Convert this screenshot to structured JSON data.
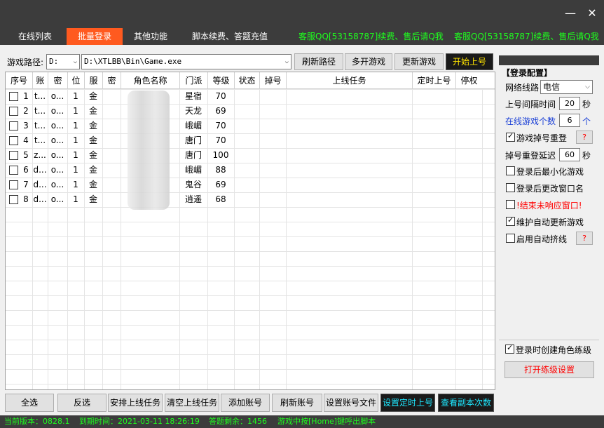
{
  "tabs": [
    {
      "label": "在线列表"
    },
    {
      "label": "批量登录"
    },
    {
      "label": "其他功能"
    },
    {
      "label": "脚本续费、答题充值"
    }
  ],
  "support": [
    "客服QQ[53158787]续费、售后请Q我",
    "客服QQ[53158787]续费、售后请Q我"
  ],
  "path": {
    "label": "游戏路径:",
    "drive": "D:",
    "exe": "D:\\XTLBB\\Bin\\Game.exe"
  },
  "toolbar": {
    "refresh_path": "刷新路径",
    "multi_open": "多开游戏",
    "update_game": "更新游戏",
    "start": "开始上号"
  },
  "table": {
    "headers": [
      "序号",
      "账",
      "密",
      "位",
      "服",
      "密",
      "角色名称",
      "门派",
      "等级",
      "状态",
      "掉号",
      "上线任务",
      "定时上号",
      "停权"
    ],
    "rows": [
      {
        "no": "1",
        "acc": "t...",
        "pwd": "o...",
        "pos": "1",
        "srv": "金",
        "sect": "星宿",
        "lvl": "70"
      },
      {
        "no": "2",
        "acc": "t...",
        "pwd": "o...",
        "pos": "1",
        "srv": "金",
        "sect": "天龙",
        "lvl": "69"
      },
      {
        "no": "3",
        "acc": "t...",
        "pwd": "o...",
        "pos": "1",
        "srv": "金",
        "sect": "峨嵋",
        "lvl": "70"
      },
      {
        "no": "4",
        "acc": "t...",
        "pwd": "o...",
        "pos": "1",
        "srv": "金",
        "sect": "唐门",
        "lvl": "70"
      },
      {
        "no": "5",
        "acc": "z...",
        "pwd": "o...",
        "pos": "1",
        "srv": "金",
        "sect": "唐门",
        "lvl": "100"
      },
      {
        "no": "6",
        "acc": "d...",
        "pwd": "o...",
        "pos": "1",
        "srv": "金",
        "sect": "峨嵋",
        "lvl": "88"
      },
      {
        "no": "7",
        "acc": "d...",
        "pwd": "o...",
        "pos": "1",
        "srv": "金",
        "sect": "鬼谷",
        "lvl": "69"
      },
      {
        "no": "8",
        "acc": "d...",
        "pwd": "o...",
        "pos": "1",
        "srv": "金",
        "sect": "逍遥",
        "lvl": "68"
      }
    ]
  },
  "bottom_buttons": [
    "全选",
    "反选",
    "安排上线任务",
    "清空上线任务",
    "添加账号",
    "刷新账号",
    "设置账号文件",
    "设置定时上号",
    "查看副本次数"
  ],
  "login_config": {
    "title": "【登录配置】",
    "line_label": "网络线路",
    "line_value": "电信",
    "interval_label": "上号间隔时间",
    "interval_value": "20",
    "interval_unit": "秒",
    "online_label": "在线游戏个数",
    "online_value": "6",
    "online_unit": "个",
    "reconnect_label": "游戏掉号重登",
    "reconnect_delay_label": "掉号重登延迟",
    "reconnect_delay_value": "60",
    "reconnect_delay_unit": "秒",
    "opt_minimize": "登录后最小化游戏",
    "opt_rename": "登录后更改窗口名",
    "opt_kill": "!结束未响应窗口!",
    "opt_autoupdate": "维护自动更新游戏",
    "opt_autoline": "启用自动挤线",
    "help": "?"
  },
  "train": {
    "create_label": "登录时创建角色练级",
    "open_btn": "打开练级设置"
  },
  "status": {
    "version": "当前版本：0828.1",
    "expire": "到期时间：2021-03-11 18:26:19",
    "quiz": "答题剩余：1456",
    "hotkey": "游戏中按[Home]键呼出脚本"
  }
}
